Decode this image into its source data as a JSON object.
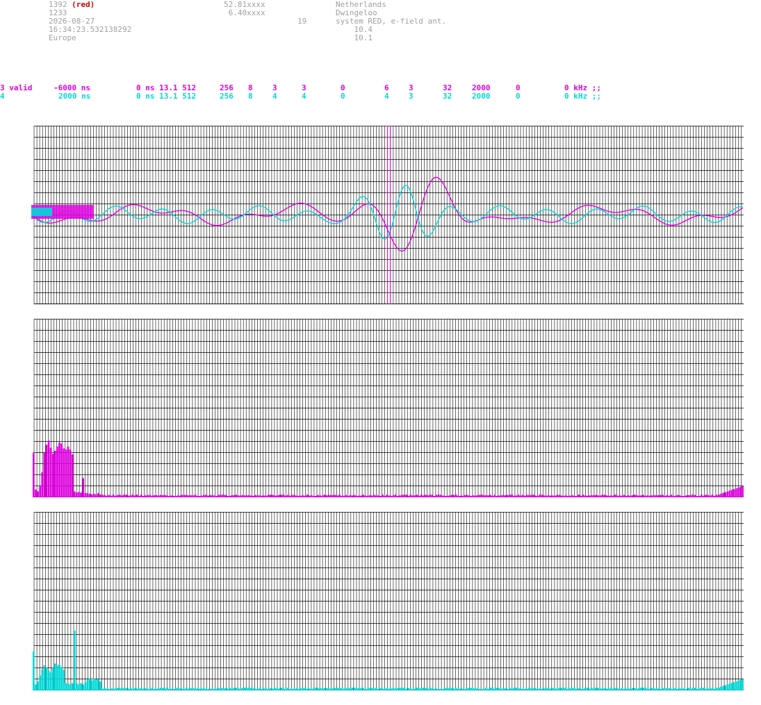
{
  "header": {
    "station_id": "1392",
    "station_tag": "(red)",
    "number2": "1233",
    "date": "2026-08-27",
    "time": "16:34:23.532138292",
    "region": "Europe",
    "lat": "52.81xxxx",
    "lon": "6.40xxxx",
    "value19": "19",
    "country": "Netherlands",
    "city": "Dwingeloo",
    "system": "system RED, e-field ant.",
    "v1": "10.4",
    "v2": "10.1"
  },
  "channels": [
    {
      "label": "3 valid",
      "offset": "-6000 ns",
      "c1": "0 ns 13.1 512",
      "c2": "256",
      "c3": "8",
      "c4": "3",
      "c5": "3",
      "c6": "0",
      "c7": "6",
      "c8": "3",
      "c9": "32",
      "c10": "2000",
      "c11": "0",
      "c12": "0 kHz ;;",
      "color": "#e000e0"
    },
    {
      "label": "4",
      "offset": "2000 ns",
      "c1": "0 ns 13.1 512",
      "c2": "256",
      "c3": "8",
      "c4": "4",
      "c5": "4",
      "c6": "0",
      "c7": "4",
      "c8": "3",
      "c9": "32",
      "c10": "2000",
      "c11": "0",
      "c12": "0 kHz ;;",
      "color": "#00d8d8"
    }
  ],
  "colors": {
    "magenta": "#e000e0",
    "cyan": "#00d8d8",
    "grid": "#000000"
  },
  "plots": {
    "waveform": {
      "marker_fraction": 0.5
    },
    "spectrum_magenta": {
      "bins": [
        0.75,
        0.13,
        0.1,
        0.2,
        0.42,
        0.75,
        0.88,
        0.95,
        0.83,
        0.73,
        0.78,
        0.85,
        0.92,
        0.9,
        0.82,
        0.8,
        0.85,
        0.8,
        0.72,
        0.1,
        0.08,
        0.09,
        0.08,
        0.32,
        0.07,
        0.07,
        0.06,
        0.05,
        0.06,
        0.05,
        0.07,
        0.05
      ]
    },
    "spectrum_cyan": {
      "bins": [
        0.65,
        0.1,
        0.15,
        0.25,
        0.35,
        0.42,
        0.38,
        0.33,
        0.3,
        0.38,
        0.45,
        0.42,
        0.43,
        0.39,
        0.35,
        0.12,
        0.12,
        0.1,
        0.12,
        1.0,
        0.12,
        0.1,
        0.12,
        0.1,
        0.13,
        0.18,
        0.2,
        0.17,
        0.2,
        0.18,
        0.19,
        0.15
      ]
    }
  }
}
